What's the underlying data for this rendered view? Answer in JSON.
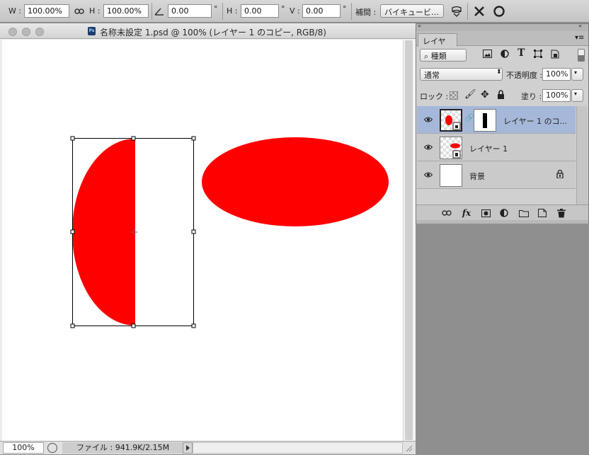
{
  "options_bar": {
    "w_label": "W :",
    "w_value": "100.00%",
    "h_label": "H :",
    "h_value": "100.00%",
    "angle_value": "0.00",
    "degree_symbol": "°",
    "hskew_label": "H :",
    "hskew_value": "0.00",
    "vskew_label": "V :",
    "vskew_value": "0.00",
    "interp_label": "補間 :",
    "interp_value": "バイキュービ…"
  },
  "document": {
    "title": "名称未設定 1.psd @ 100% (レイヤー 1 のコピー, RGB/8)",
    "zoom": "100%",
    "file_info": "ファイル : 941.9K/2.15M",
    "shape_color": "#ff0000"
  },
  "layers_panel": {
    "tab_label": "レイヤー",
    "filter_kind": "種類",
    "blend_mode": "通常",
    "opacity_label": "不透明度 :",
    "opacity_value": "100%",
    "lock_label": "ロック :",
    "fill_label": "塗り :",
    "fill_value": "100%",
    "layers": [
      {
        "name": "レイヤー 1 のコ...",
        "selected": true
      },
      {
        "name": "レイヤー 1",
        "selected": false
      },
      {
        "name": "背景",
        "selected": false
      }
    ]
  }
}
